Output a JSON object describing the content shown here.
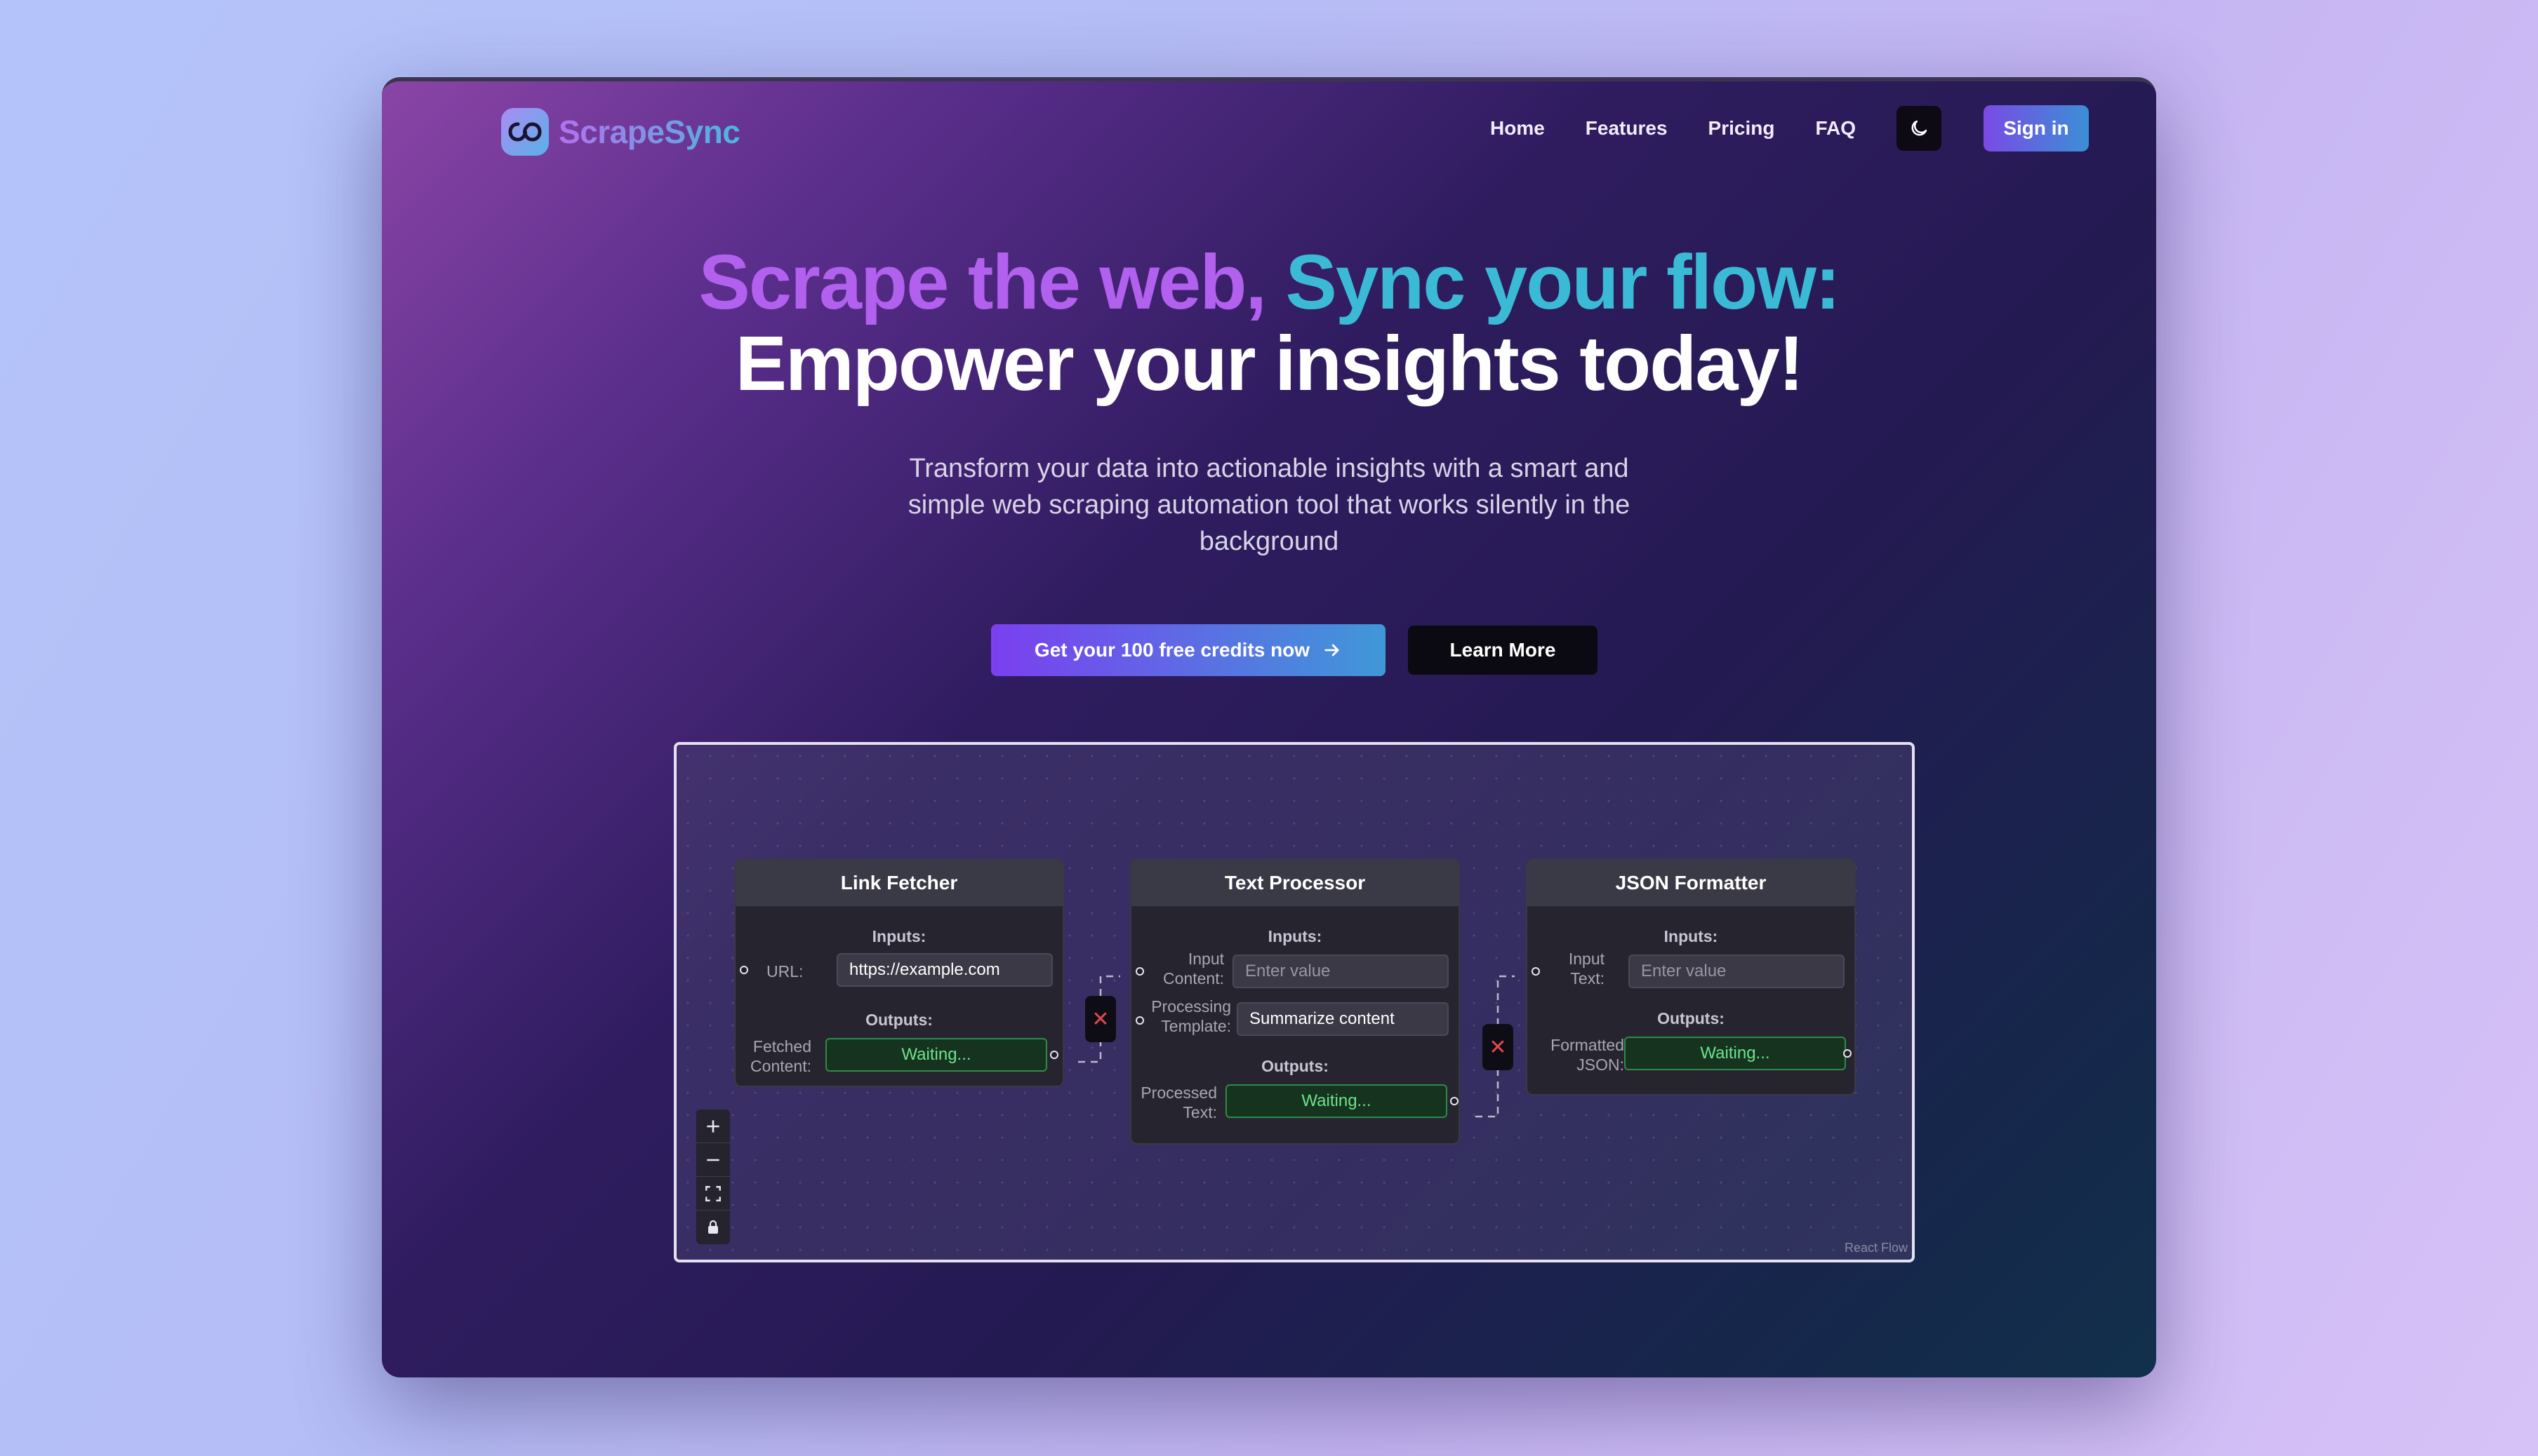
{
  "brand": {
    "name": "ScrapeSync",
    "logo_icon": "infinity-icon"
  },
  "nav": {
    "links": [
      "Home",
      "Features",
      "Pricing",
      "FAQ"
    ],
    "theme_icon": "moon-icon",
    "signin_label": "Sign in"
  },
  "hero": {
    "title_part1": "Scrape the web, ",
    "title_part2": "Sync your flow:",
    "title_line2": "Empower your insights today!",
    "subtitle": "Transform your data into actionable insights with a smart and simple web scraping automation tool that works silently in the background",
    "cta_primary": "Get your 100 free credits now",
    "cta_secondary": "Learn More"
  },
  "flow": {
    "nodes": [
      {
        "title": "Link Fetcher",
        "inputs_label": "Inputs:",
        "outputs_label": "Outputs:",
        "input_fields": [
          {
            "label": "URL:",
            "value": "https://example.com"
          }
        ],
        "output_fields": [
          {
            "label": "Fetched Content:",
            "value": "Waiting..."
          }
        ]
      },
      {
        "title": "Text Processor",
        "inputs_label": "Inputs:",
        "outputs_label": "Outputs:",
        "input_fields": [
          {
            "label": "Input Content:",
            "placeholder": "Enter value"
          },
          {
            "label": "Processing Template:",
            "value": "Summarize content"
          }
        ],
        "output_fields": [
          {
            "label": "Processed Text:",
            "value": "Waiting..."
          }
        ]
      },
      {
        "title": "JSON Formatter",
        "inputs_label": "Inputs:",
        "outputs_label": "Outputs:",
        "input_fields": [
          {
            "label": "Input Text:",
            "placeholder": "Enter value"
          }
        ],
        "output_fields": [
          {
            "label": "Formatted JSON:",
            "value": "Waiting..."
          }
        ]
      }
    ],
    "edge_delete_icon": "✕",
    "controls": [
      "zoom-in-icon",
      "zoom-out-icon",
      "fit-view-icon",
      "lock-icon"
    ],
    "attribution": "React Flow"
  },
  "colors": {
    "accent_purple": "#b260ee",
    "accent_teal": "#3bbad6",
    "output_green": "#6ee28c",
    "delete_red": "#e5484d"
  }
}
